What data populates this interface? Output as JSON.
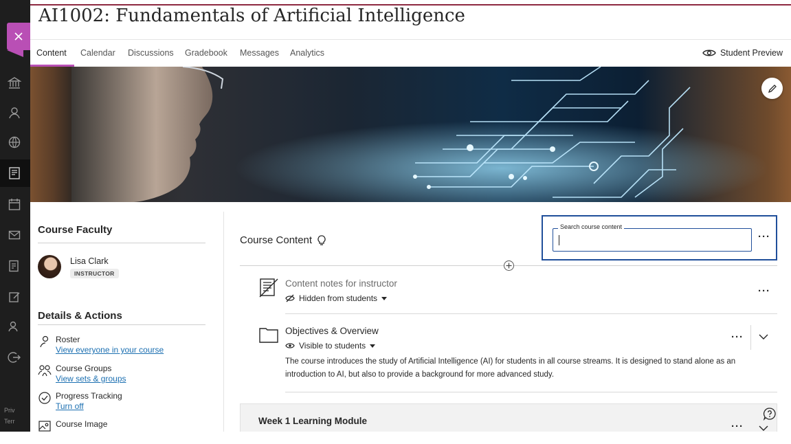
{
  "course": {
    "title": "AI1002: Fundamentals of Artificial Intelligence"
  },
  "tabs": [
    {
      "label": "Content",
      "active": true
    },
    {
      "label": "Calendar"
    },
    {
      "label": "Discussions"
    },
    {
      "label": "Gradebook"
    },
    {
      "label": "Messages"
    },
    {
      "label": "Analytics"
    }
  ],
  "student_preview": {
    "label": "Student Preview"
  },
  "rail": {
    "icons": [
      "institution-icon",
      "profile-icon",
      "globe-icon",
      "courses-icon",
      "calendar-icon",
      "messages-icon",
      "grades-icon",
      "tools-icon",
      "groups-icon",
      "sign-out-icon"
    ],
    "footer": [
      "Priv",
      "Terr"
    ]
  },
  "faculty": {
    "heading": "Course Faculty",
    "name": "Lisa Clark",
    "role": "INSTRUCTOR"
  },
  "details": {
    "heading": "Details & Actions",
    "items": [
      {
        "title": "Roster",
        "link": "View everyone in your course",
        "icon": "roster-icon"
      },
      {
        "title": "Course Groups",
        "link": "View sets & groups",
        "icon": "groups-icon"
      },
      {
        "title": "Progress Tracking",
        "link": "Turn off",
        "icon": "check-circle-icon"
      },
      {
        "title": "Course Image",
        "icon": "image-icon"
      }
    ]
  },
  "content": {
    "heading": "Course Content",
    "search": {
      "label": "Search course content",
      "value": ""
    },
    "items": [
      {
        "title": "Content notes for instructor",
        "visibility": "Hidden from students",
        "icon": "document-icon"
      },
      {
        "title": "Objectives & Overview",
        "visibility": "Visible to students",
        "icon": "folder-icon",
        "description": "The course introduces the study of Artificial Intelligence (AI) for students in all course streams. It is designed to stand alone as an introduction to AI, but also to provide a background for more advanced study."
      },
      {
        "title": "Week 1 Learning Module"
      }
    ]
  },
  "colors": {
    "accent": "#b94fb5",
    "link": "#1b6fb1",
    "focus": "#1f4e9a",
    "rail": "#1e1e1e"
  }
}
